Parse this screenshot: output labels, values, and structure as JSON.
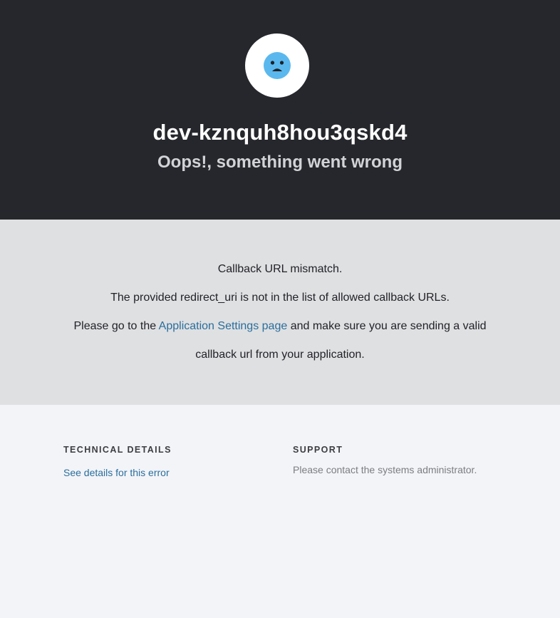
{
  "header": {
    "icon": "sad-face-icon",
    "tenant_name": "dev-kznquh8hou3qskd4",
    "subtitle": "Oops!, something went wrong"
  },
  "message": {
    "line1": "Callback URL mismatch.",
    "line2": "The provided redirect_uri is not in the list of allowed callback URLs.",
    "line3_prefix": "Please go to the ",
    "line3_link": "Application Settings page",
    "line3_suffix": " and make sure you are sending a valid",
    "line4": "callback url from your application."
  },
  "footer": {
    "technical_heading": "TECHNICAL DETAILS",
    "details_link": "See details for this error",
    "support_heading": "SUPPORT",
    "support_text": "Please contact the systems administrator."
  },
  "colors": {
    "header_bg": "#26272c",
    "message_bg": "#dfe0e2",
    "footer_bg": "#f3f4f8",
    "link": "#2a6e9c",
    "face": "#5bb8ee"
  }
}
